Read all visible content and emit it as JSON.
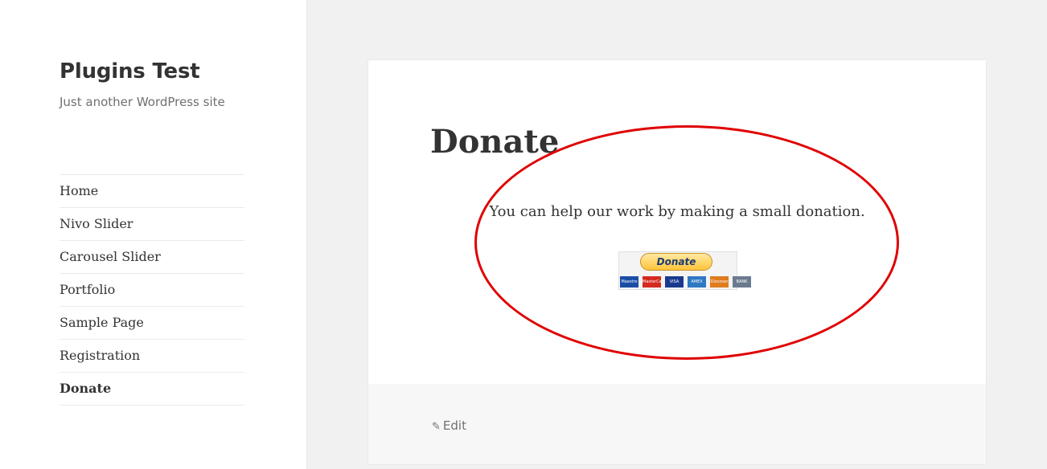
{
  "site": {
    "title": "Plugins Test",
    "description": "Just another WordPress site"
  },
  "nav": {
    "items": [
      {
        "label": "Home"
      },
      {
        "label": "Nivo Slider"
      },
      {
        "label": "Carousel Slider"
      },
      {
        "label": "Portfolio"
      },
      {
        "label": "Sample Page"
      },
      {
        "label": "Registration"
      },
      {
        "label": "Donate",
        "current": true
      }
    ]
  },
  "page": {
    "title": "Donate",
    "text": "You can help our work by making a small donation.",
    "donate_button": {
      "label": "Donate",
      "cards": [
        {
          "label": "Maestro",
          "color": "#1a4ea6"
        },
        {
          "label": "MasterCard",
          "color": "#d42a1f"
        },
        {
          "label": "VISA",
          "color": "#1a3a8e"
        },
        {
          "label": "AMEX",
          "color": "#2f78c4"
        },
        {
          "label": "Discover",
          "color": "#e07b1f"
        },
        {
          "label": "BANK",
          "color": "#6b7a8f"
        }
      ]
    },
    "edit_label": "Edit"
  },
  "colors": {
    "annotation": "#e00000",
    "background": "#f1f1f1"
  },
  "icons": {
    "edit": "pencil-icon"
  }
}
